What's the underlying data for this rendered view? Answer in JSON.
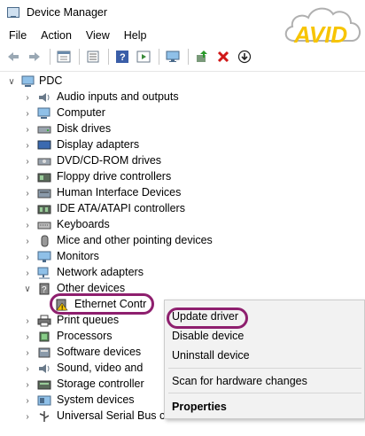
{
  "window": {
    "title": "Device Manager"
  },
  "logo": {
    "text": "AVID",
    "colors": {
      "cloud": "#b0b0b0",
      "letters": "#f7c400"
    }
  },
  "menu": [
    "File",
    "Action",
    "View",
    "Help"
  ],
  "toolbar": [
    "back-icon",
    "forward-icon",
    "properties-window-icon",
    "list-view-icon",
    "help-icon",
    "show-hide-pane-icon",
    "monitor-icon",
    "update-driver-icon",
    "uninstall-icon",
    "scan-download-icon"
  ],
  "tree": {
    "root": "PDC",
    "items": [
      {
        "label": "Audio inputs and outputs",
        "icon": "speaker-icon"
      },
      {
        "label": "Computer",
        "icon": "computer-icon"
      },
      {
        "label": "Disk drives",
        "icon": "disk-drive-icon"
      },
      {
        "label": "Display adapters",
        "icon": "display-adapter-icon"
      },
      {
        "label": "DVD/CD-ROM drives",
        "icon": "dvd-drive-icon"
      },
      {
        "label": "Floppy drive controllers",
        "icon": "floppy-controller-icon"
      },
      {
        "label": "Human Interface Devices",
        "icon": "hid-icon"
      },
      {
        "label": "IDE ATA/ATAPI controllers",
        "icon": "ide-controller-icon"
      },
      {
        "label": "Keyboards",
        "icon": "keyboard-icon"
      },
      {
        "label": "Mice and other pointing devices",
        "icon": "mouse-icon"
      },
      {
        "label": "Monitors",
        "icon": "monitor-icon"
      },
      {
        "label": "Network adapters",
        "icon": "network-adapter-icon"
      },
      {
        "label": "Other devices",
        "icon": "other-devices-icon",
        "expanded": true
      },
      {
        "label": "Ethernet Contr",
        "icon": "warning-device-icon",
        "child": true
      },
      {
        "label": "Print queues",
        "icon": "printer-icon"
      },
      {
        "label": "Processors",
        "icon": "processor-icon"
      },
      {
        "label": "Software devices",
        "icon": "software-device-icon"
      },
      {
        "label": "Sound, video and",
        "icon": "sound-icon"
      },
      {
        "label": "Storage controller",
        "icon": "storage-controller-icon"
      },
      {
        "label": "System devices",
        "icon": "system-device-icon"
      },
      {
        "label": "Universal Serial Bus controller",
        "icon": "usb-icon"
      }
    ]
  },
  "context_menu": {
    "items": [
      "Update driver",
      "Disable device",
      "Uninstall device",
      "Scan for hardware changes",
      "Properties"
    ]
  },
  "colors": {
    "highlight_ring": "#8e1f6e",
    "menu_bg": "#f2f2f2"
  }
}
